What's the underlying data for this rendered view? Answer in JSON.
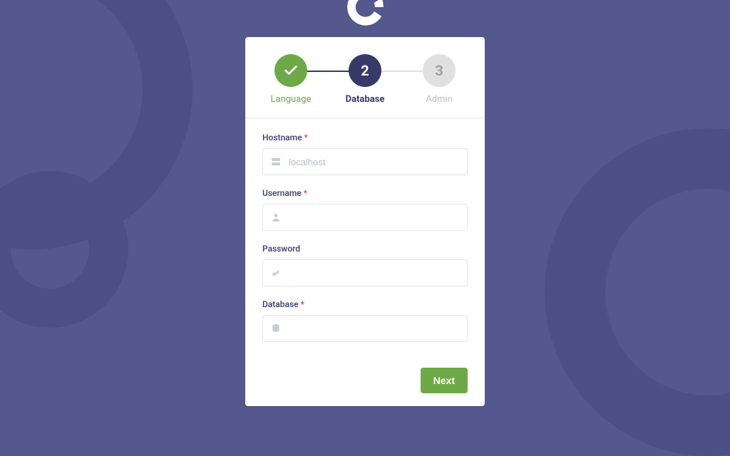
{
  "stepper": {
    "steps": [
      {
        "label": "Language",
        "state": "done",
        "num": "1"
      },
      {
        "label": "Database",
        "state": "active",
        "num": "2"
      },
      {
        "label": "Admin",
        "state": "future",
        "num": "3"
      }
    ]
  },
  "form": {
    "hostname": {
      "label": "Hostname",
      "required": true,
      "placeholder": "localhost",
      "value": ""
    },
    "username": {
      "label": "Username",
      "required": true,
      "placeholder": "",
      "value": ""
    },
    "password": {
      "label": "Password",
      "required": false,
      "placeholder": "",
      "value": ""
    },
    "database": {
      "label": "Database",
      "required": true,
      "placeholder": "",
      "value": ""
    }
  },
  "actions": {
    "next": "Next"
  }
}
